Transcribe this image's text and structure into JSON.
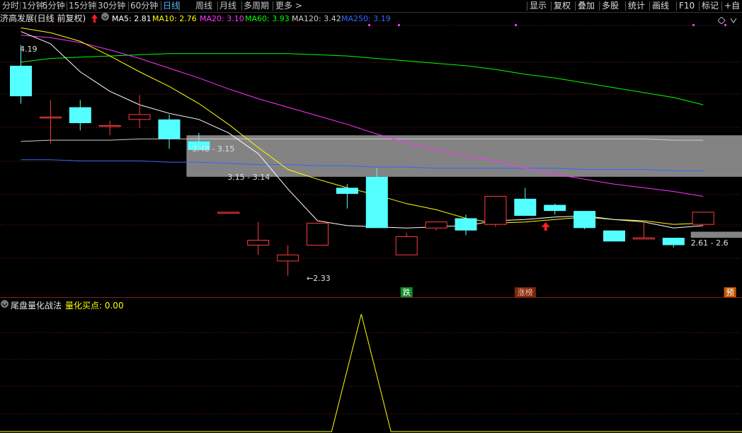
{
  "toolbar": {
    "periods": [
      "分时",
      "1分钟",
      "5分钟",
      "15分钟",
      "30分钟",
      "60分钟",
      "日线",
      "周线",
      "月线",
      "多周期",
      "更多 >"
    ],
    "active_period": "日线",
    "right_buttons": [
      "显示",
      "复权",
      "叠加",
      "多股",
      "统计",
      "画线",
      "F10",
      "标记",
      "+自"
    ]
  },
  "legend": {
    "stock_title": "济高发展(日线 前复权)",
    "ma": [
      {
        "label": "MA5: 2.81",
        "color": "#ffffff"
      },
      {
        "label": "MA10: 2.76",
        "color": "#ffff00"
      },
      {
        "label": "MA20: 3.10",
        "color": "#ff33ff"
      },
      {
        "label": "MA60: 3.93",
        "color": "#00ff00"
      },
      {
        "label": "MA120: 3.42",
        "color": "#cccccc"
      },
      {
        "label": "MA250: 3.19",
        "color": "#3366ff"
      }
    ],
    "expand_icon": "diamond-icon",
    "up_arrow_icon": "up-arrow-icon",
    "collapse_icon": "collapse-circle-icon"
  },
  "chart_data": {
    "type": "candlestick",
    "price_range": [
      2.2,
      4.38
    ],
    "candles": [
      {
        "o": 4.05,
        "h": 4.22,
        "l": 3.74,
        "c": 3.8
      },
      {
        "o": 3.63,
        "h": 3.77,
        "l": 3.41,
        "c": 3.63
      },
      {
        "o": 3.71,
        "h": 3.77,
        "l": 3.52,
        "c": 3.58
      },
      {
        "o": 3.56,
        "h": 3.6,
        "l": 3.48,
        "c": 3.56
      },
      {
        "o": 3.61,
        "h": 3.81,
        "l": 3.54,
        "c": 3.65
      },
      {
        "o": 3.61,
        "h": 3.65,
        "l": 3.37,
        "c": 3.45
      },
      {
        "o": 3.43,
        "h": 3.5,
        "l": 3.36,
        "c": 3.36
      },
      {
        "o": 2.85,
        "h": 2.85,
        "l": 2.85,
        "c": 2.85
      },
      {
        "o": 2.58,
        "h": 2.77,
        "l": 2.5,
        "c": 2.62
      },
      {
        "o": 2.45,
        "h": 2.58,
        "l": 2.33,
        "c": 2.5
      },
      {
        "o": 2.58,
        "h": 2.76,
        "l": 2.58,
        "c": 2.76
      },
      {
        "o": 3.05,
        "h": 3.08,
        "l": 2.88,
        "c": 3.0
      },
      {
        "o": 3.14,
        "h": 3.21,
        "l": 2.72,
        "c": 2.72
      },
      {
        "o": 2.5,
        "h": 2.68,
        "l": 2.5,
        "c": 2.65
      },
      {
        "o": 2.72,
        "h": 2.77,
        "l": 2.7,
        "c": 2.77
      },
      {
        "o": 2.8,
        "h": 2.83,
        "l": 2.66,
        "c": 2.7
      },
      {
        "o": 2.75,
        "h": 2.98,
        "l": 2.73,
        "c": 2.98
      },
      {
        "o": 2.96,
        "h": 3.05,
        "l": 2.82,
        "c": 2.82
      },
      {
        "o": 2.91,
        "h": 2.92,
        "l": 2.83,
        "c": 2.86
      },
      {
        "o": 2.86,
        "h": 2.86,
        "l": 2.71,
        "c": 2.72
      },
      {
        "o": 2.7,
        "h": 2.7,
        "l": 2.61,
        "c": 2.61
      },
      {
        "o": 2.63,
        "h": 2.77,
        "l": 2.63,
        "c": 2.64
      },
      {
        "o": 2.64,
        "h": 2.64,
        "l": 2.56,
        "c": 2.58
      },
      {
        "o": 2.75,
        "h": 2.85,
        "l": 2.75,
        "c": 2.85
      }
    ],
    "ma5": [
      4.33,
      4.23,
      4.0,
      3.84,
      3.73,
      3.66,
      3.61,
      3.5,
      3.33,
      3.04,
      2.78,
      2.74,
      2.73,
      2.72,
      2.73,
      2.74,
      2.78,
      2.79,
      2.81,
      2.82,
      2.79,
      2.77,
      2.72,
      2.74
    ],
    "ma10": [
      4.36,
      4.32,
      4.25,
      4.13,
      4.0,
      3.88,
      3.74,
      3.57,
      3.38,
      3.2,
      3.12,
      3.05,
      2.99,
      2.92,
      2.87,
      2.8,
      2.76,
      2.77,
      2.79,
      2.81,
      2.79,
      2.78,
      2.75,
      2.76
    ],
    "ma20": [
      4.3,
      4.28,
      4.24,
      4.18,
      4.11,
      4.03,
      3.95,
      3.86,
      3.78,
      3.71,
      3.64,
      3.57,
      3.49,
      3.42,
      3.36,
      3.31,
      3.27,
      3.21,
      3.16,
      3.12,
      3.08,
      3.05,
      3.02,
      2.98
    ],
    "ma60": [
      4.08,
      4.11,
      4.12,
      4.13,
      4.14,
      4.15,
      4.15,
      4.15,
      4.15,
      4.15,
      4.14,
      4.13,
      4.11,
      4.09,
      4.07,
      4.05,
      4.02,
      3.98,
      3.95,
      3.91,
      3.87,
      3.83,
      3.79,
      3.73
    ],
    "ma120": [
      3.43,
      3.44,
      3.44,
      3.44,
      3.45,
      3.45,
      3.45,
      3.45,
      3.45,
      3.45,
      3.45,
      3.45,
      3.45,
      3.45,
      3.45,
      3.45,
      3.45,
      3.45,
      3.45,
      3.45,
      3.45,
      3.45,
      3.44,
      3.44
    ],
    "ma250": [
      3.28,
      3.28,
      3.27,
      3.27,
      3.27,
      3.26,
      3.26,
      3.25,
      3.24,
      3.24,
      3.23,
      3.23,
      3.22,
      3.22,
      3.21,
      3.21,
      3.21,
      3.21,
      3.21,
      3.2,
      3.2,
      3.2,
      3.19,
      3.19
    ],
    "annotations": [
      {
        "text": "4.19",
        "candle": 0,
        "price": 4.19
      },
      {
        "text": "3.48 - 3.15",
        "candle": 6,
        "price": 3.37
      },
      {
        "text": "3.15 - 3.14",
        "candle": 7,
        "price": 3.14
      },
      {
        "text": "←2.33",
        "candle": 10,
        "price": 2.31
      },
      {
        "text": "2.61 - 2.6",
        "candle": 23,
        "price": 2.6
      }
    ],
    "zones": [
      {
        "from_candle": 6,
        "low": 3.14,
        "high": 3.48,
        "color": "#8a8a8a"
      },
      {
        "from_candle": 23,
        "low": 2.64,
        "high": 2.69,
        "color": "#8a8a8a"
      }
    ],
    "markers": [
      {
        "text": "跌",
        "candle": 13,
        "bg": "#138a2c",
        "fg": "#ffffff"
      },
      {
        "text": "涨榜",
        "candle": 17,
        "bg": "#7a2a0a",
        "fg": "#ffbbaa"
      },
      {
        "text": "预",
        "candle": 24,
        "bg": "#c45a00",
        "fg": "#ffffff"
      }
    ],
    "up_arrow_candle": 18,
    "indicator": {
      "name": "尾盘量化战法",
      "series_name": "量化买点",
      "current": "0.00",
      "values": [
        0,
        0,
        0,
        0,
        0,
        0,
        0,
        0,
        0,
        0,
        0,
        0,
        1,
        0,
        0,
        0,
        0,
        0,
        0,
        0,
        0,
        0,
        0,
        0
      ],
      "line_color": "#ffff00"
    }
  },
  "colors": {
    "up": "#ff3c3c",
    "down": "#54ffff",
    "grid": "#8a1a1a",
    "panel_border": "#8a1a1a",
    "active_period": "#4fb4ff"
  }
}
